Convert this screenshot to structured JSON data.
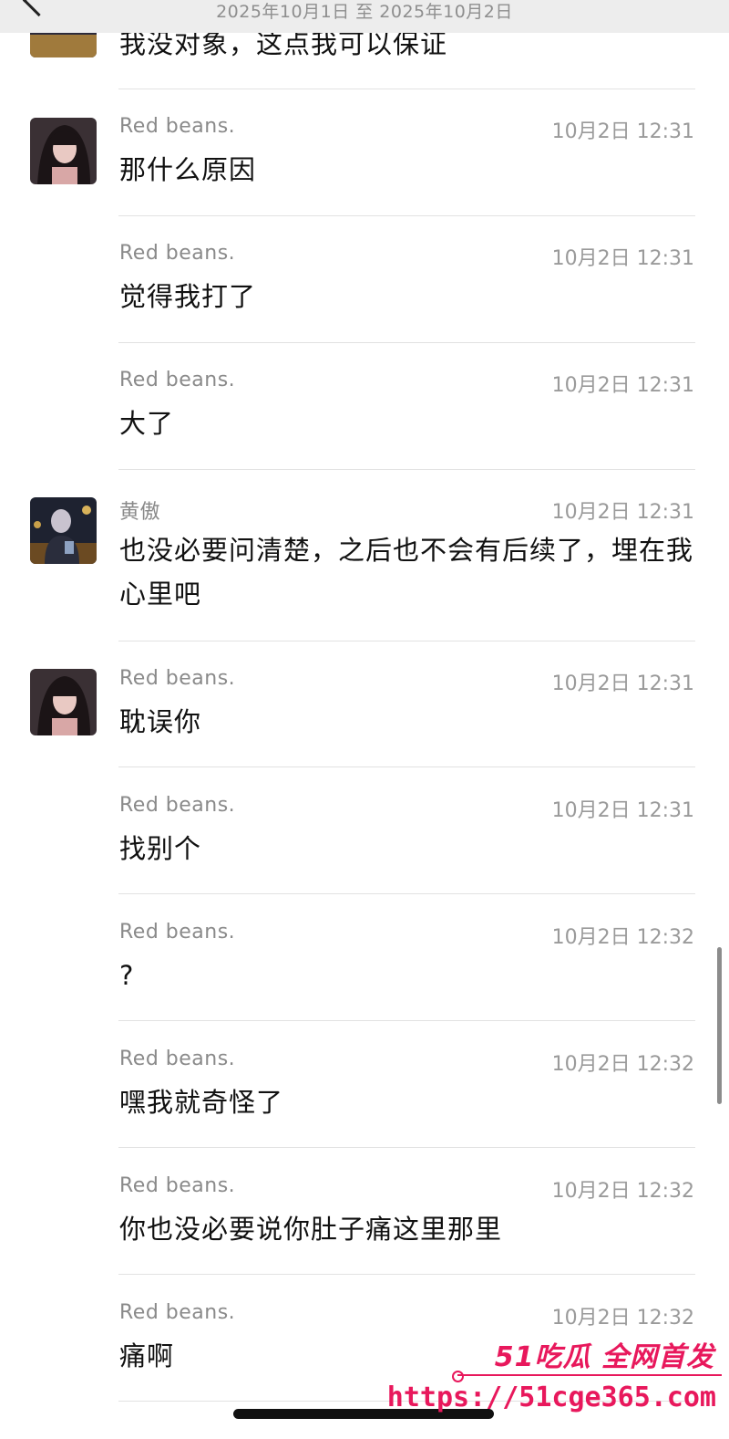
{
  "header": {
    "date_range": "2025年10月1日 至 2025年10月2日"
  },
  "colors": {
    "watermark": "#e8185c",
    "header_bg": "#ededed"
  },
  "first_partial_message": {
    "text": "我没对象，这点我可以保证"
  },
  "messages": [
    {
      "sender": "Red  beans.",
      "time": "10月2日 12:31",
      "text": "那什么原因",
      "avatar": "girl-avatar"
    },
    {
      "sender": "Red  beans.",
      "time": "10月2日 12:31",
      "text": "觉得我打了"
    },
    {
      "sender": "Red  beans.",
      "time": "10月2日 12:31",
      "text": "大了"
    },
    {
      "sender": "黄傲",
      "time": "10月2日 12:31",
      "text": "也没必要问清楚，之后也不会有后续了，埋在我心里吧",
      "avatar": "man-avatar"
    },
    {
      "sender": "Red  beans.",
      "time": "10月2日 12:31",
      "text": "耽误你",
      "avatar": "girl-avatar"
    },
    {
      "sender": "Red  beans.",
      "time": "10月2日 12:31",
      "text": "找别个"
    },
    {
      "sender": "Red  beans.",
      "time": "10月2日 12:32",
      "text": "?"
    },
    {
      "sender": "Red  beans.",
      "time": "10月2日 12:32",
      "text": "嘿我就奇怪了"
    },
    {
      "sender": "Red  beans.",
      "time": "10月2日 12:32",
      "text": "你也没必要说你肚子痛这里那里"
    },
    {
      "sender": "Red  beans.",
      "time": "10月2日 12:32",
      "text": "痛啊"
    }
  ],
  "watermark": {
    "brand": "51吃瓜 全网首发",
    "url": "https://51cge365.com"
  }
}
